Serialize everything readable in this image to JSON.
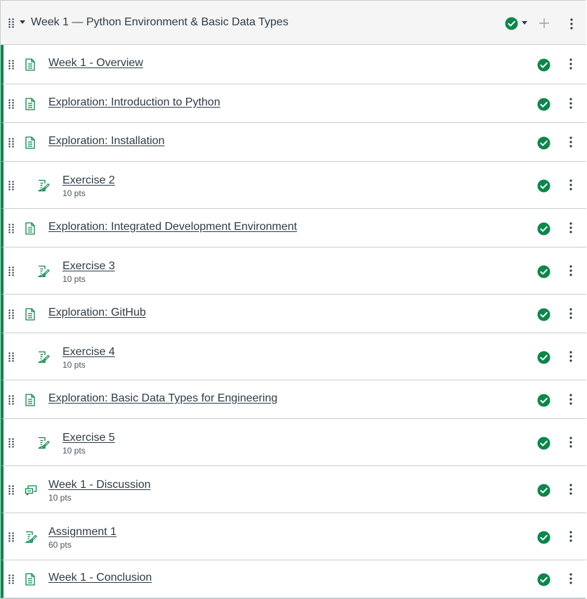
{
  "module": {
    "title": "Week 1 — Python Environment & Basic Data Types",
    "status_icon": "published-check-icon",
    "accent_color": "#0b874b"
  },
  "items": [
    {
      "title": "Week 1 - Overview",
      "icon": "page-icon",
      "points": "",
      "indent": 0
    },
    {
      "title": "Exploration: Introduction to Python",
      "icon": "page-icon",
      "points": "",
      "indent": 0
    },
    {
      "title": "Exploration: Installation",
      "icon": "page-icon",
      "points": "",
      "indent": 0
    },
    {
      "title": "Exercise 2",
      "icon": "assignment-icon",
      "points": "10 pts",
      "indent": 1
    },
    {
      "title": "Exploration: Integrated Development Environment",
      "icon": "page-icon",
      "points": "",
      "indent": 0
    },
    {
      "title": "Exercise 3",
      "icon": "assignment-icon",
      "points": "10 pts",
      "indent": 1
    },
    {
      "title": "Exploration: GitHub",
      "icon": "page-icon",
      "points": "",
      "indent": 0
    },
    {
      "title": "Exercise 4",
      "icon": "assignment-icon",
      "points": "10 pts",
      "indent": 1
    },
    {
      "title": "Exploration: Basic Data Types for Engineering",
      "icon": "page-icon",
      "points": "",
      "indent": 0
    },
    {
      "title": "Exercise 5",
      "icon": "assignment-icon",
      "points": "10 pts",
      "indent": 1
    },
    {
      "title": "Week 1 - Discussion",
      "icon": "discussion-icon",
      "points": "10 pts",
      "indent": 0
    },
    {
      "title": "Assignment 1",
      "icon": "assignment-icon",
      "points": "60 pts",
      "indent": 0
    },
    {
      "title": "Week 1 - Conclusion",
      "icon": "page-icon",
      "points": "",
      "indent": 0
    }
  ]
}
